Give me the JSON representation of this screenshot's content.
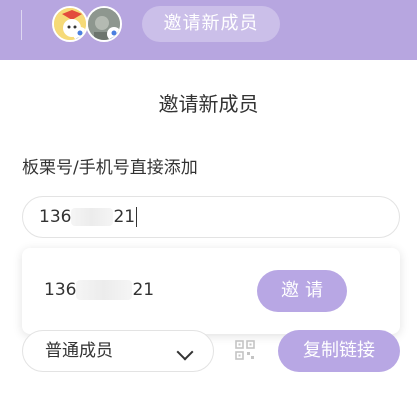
{
  "header": {
    "invite_button_label": "邀请新成员",
    "avatars": [
      {
        "icon": "user-avatar-cartoon"
      },
      {
        "icon": "user-avatar-photo"
      }
    ]
  },
  "dialog": {
    "title": "邀请新成员",
    "section_label": "板栗号/手机号直接添加",
    "phone_input": {
      "value_prefix": "136",
      "value_suffix": "21"
    },
    "result": {
      "number_prefix": "136",
      "number_suffix": "21",
      "invite_label": "邀请"
    },
    "role_select": {
      "selected": "普通成员"
    },
    "copy_link_label": "复制链接"
  },
  "colors": {
    "accent": "#b8a7e4",
    "header_bg": "#b7a6e0"
  }
}
